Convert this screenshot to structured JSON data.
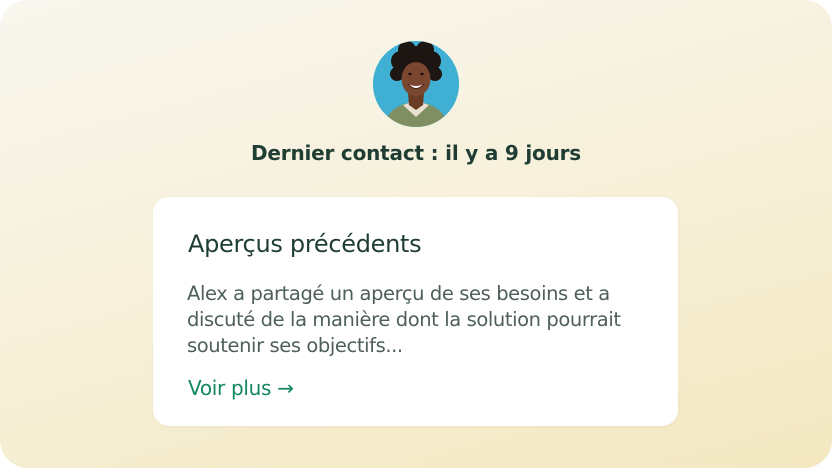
{
  "contact": {
    "avatar_icon": "person-avatar",
    "last_contact_text": "Dernier contact : il y a 9 jours"
  },
  "card": {
    "title": "Aperçus précédents",
    "body": "Alex a partagé un aperçu de ses besoins et a discuté de la manière dont la solution pourrait soutenir ses objectifs...",
    "link_label": "Voir plus →"
  },
  "colors": {
    "heading": "#1f3d33",
    "body_text": "#4d5f58",
    "link": "#13875f",
    "card_background": "#ffffff",
    "avatar_background": "#3fb0d4"
  }
}
